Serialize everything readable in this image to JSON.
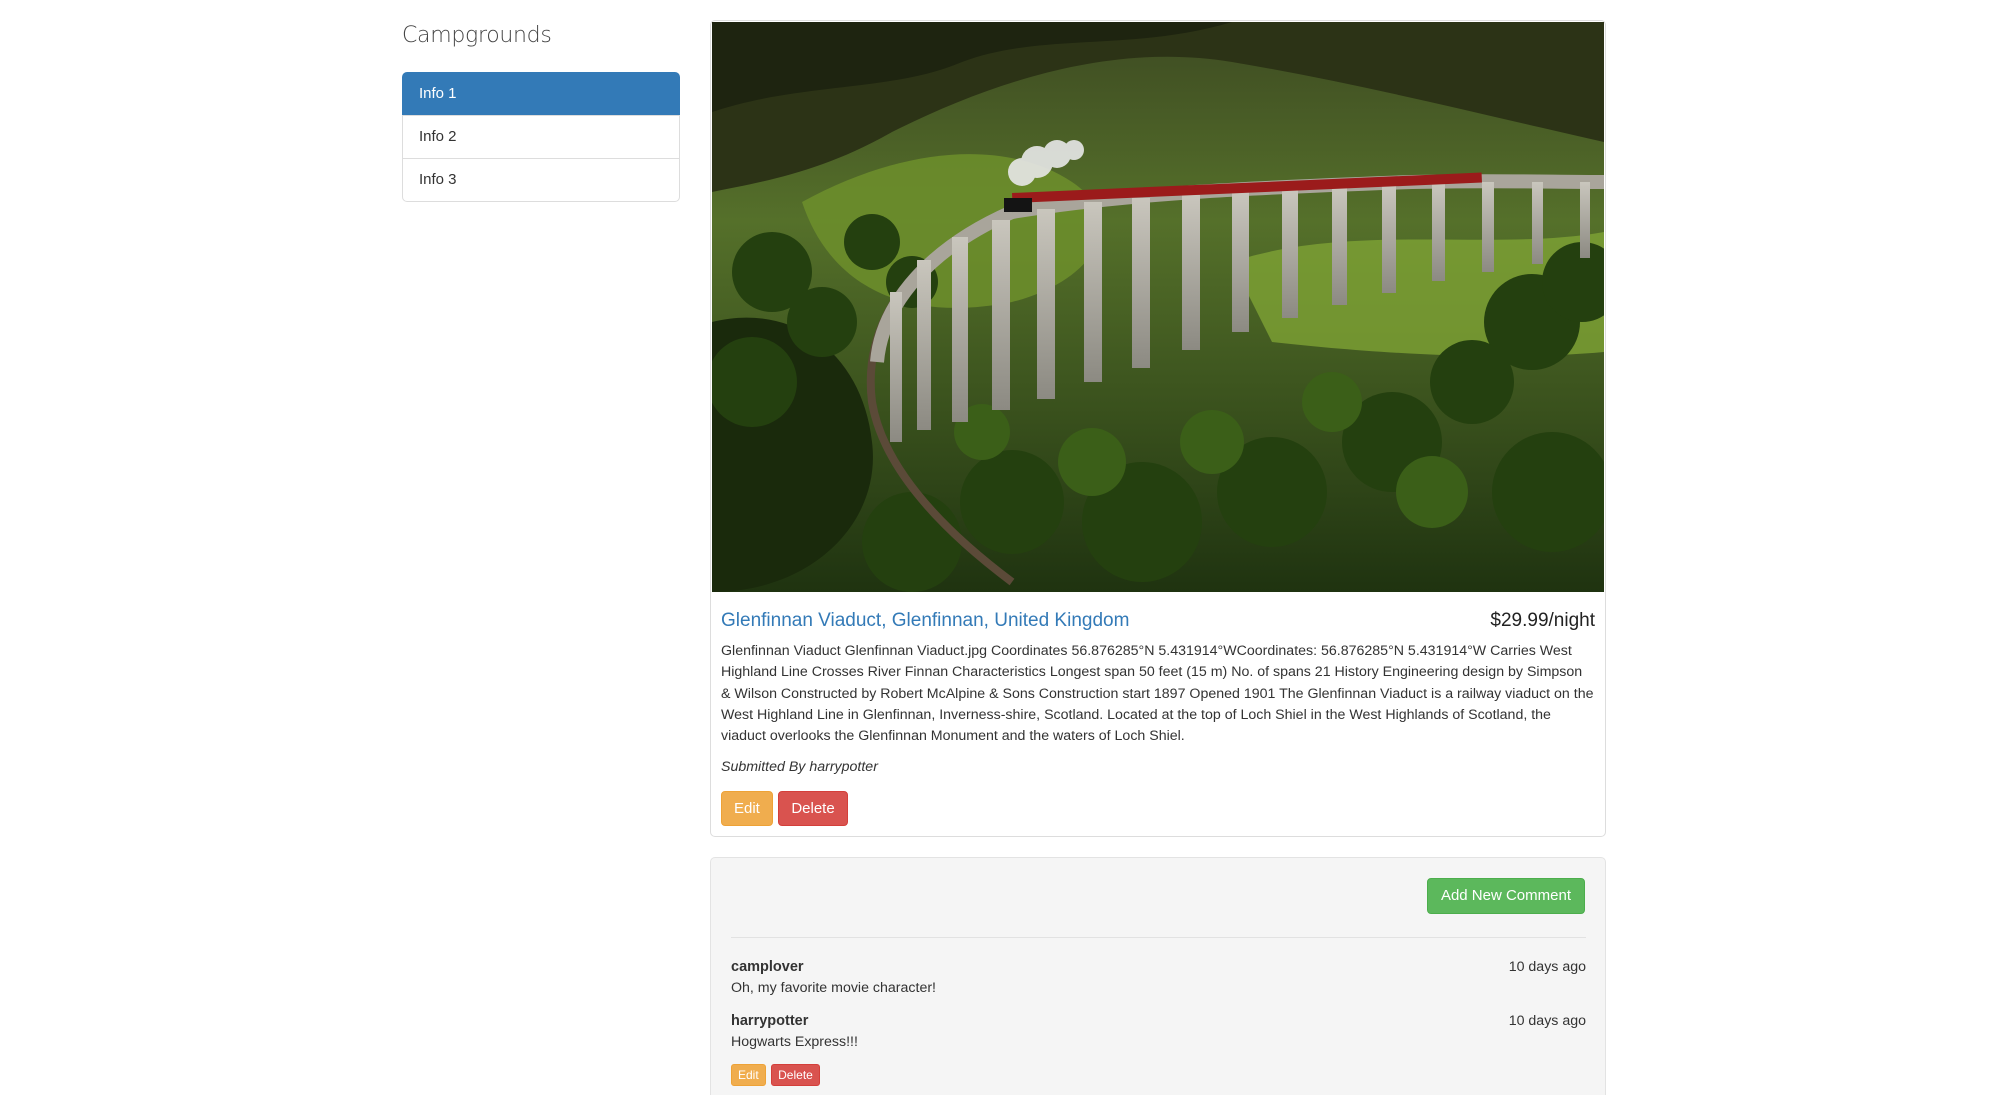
{
  "sidebar": {
    "heading": "Campgrounds",
    "items": [
      {
        "label": "Info 1",
        "active": true
      },
      {
        "label": "Info 2",
        "active": false
      },
      {
        "label": "Info 3",
        "active": false
      }
    ]
  },
  "campground": {
    "image_subject": "Steam train crossing the curved stone arches of Glenfinnan Viaduct through green hills",
    "name": "Glenfinnan Viaduct, Glenfinnan, United Kingdom",
    "price": "$29.99/night",
    "description": "Glenfinnan Viaduct Glenfinnan Viaduct.jpg Coordinates 56.876285°N 5.431914°WCoordinates: 56.876285°N 5.431914°W Carries West Highland Line Crosses River Finnan Characteristics Longest span 50 feet (15 m) No. of spans 21 History Engineering design by Simpson & Wilson Constructed by Robert McAlpine & Sons Construction start 1897 Opened 1901 The Glenfinnan Viaduct is a railway viaduct on the West Highland Line in Glenfinnan, Inverness-shire, Scotland. Located at the top of Loch Shiel in the West Highlands of Scotland, the viaduct overlooks the Glenfinnan Monument and the waters of Loch Shiel.",
    "submitted_by": "Submitted By harrypotter",
    "edit_label": "Edit",
    "delete_label": "Delete"
  },
  "comments": {
    "add_label": "Add New Comment",
    "items": [
      {
        "author": "camplover",
        "time": "10 days ago",
        "text": "Oh, my favorite movie character!",
        "edit_label": "",
        "delete_label": ""
      },
      {
        "author": "harrypotter",
        "time": "10 days ago",
        "text": "Hogwarts Express!!!",
        "edit_label": "Edit",
        "delete_label": "Delete"
      }
    ]
  },
  "colors": {
    "primary": "#337ab7",
    "warning": "#f0ad4e",
    "danger": "#d9534f",
    "success": "#5cb85c"
  }
}
